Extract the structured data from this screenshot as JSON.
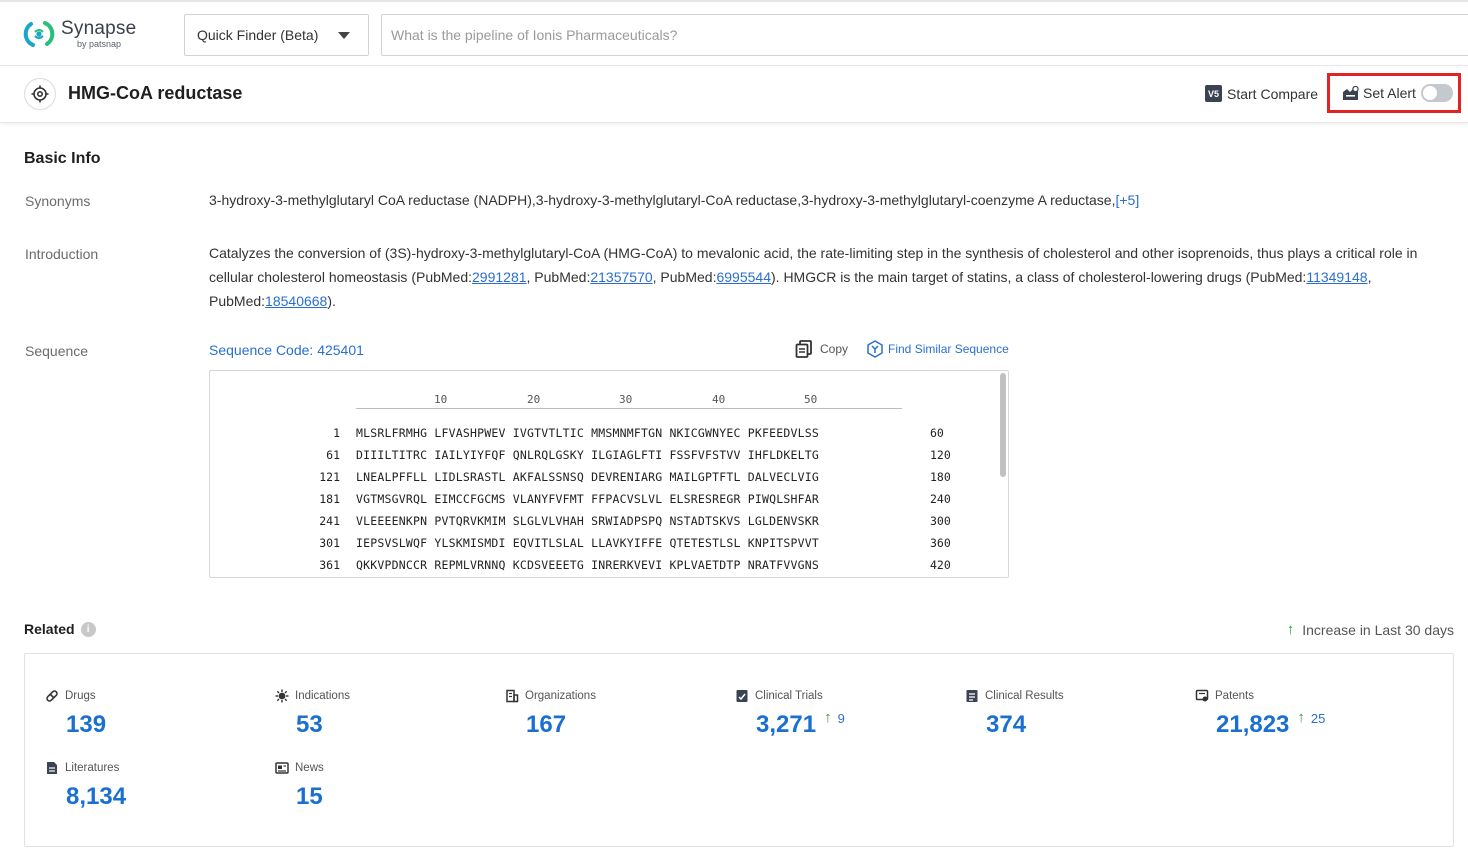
{
  "header": {
    "logo_name": "Synapse",
    "logo_by": "by patsnap",
    "finder_label": "Quick Finder (Beta)",
    "search_placeholder": "What is the pipeline of Ionis Pharmaceuticals?"
  },
  "titlebar": {
    "title": "HMG-CoA reductase",
    "compare_badge": "V5",
    "compare_label": "Start Compare",
    "alert_label": "Set Alert",
    "alert_enabled": false
  },
  "basic_info": {
    "section_title": "Basic Info",
    "synonyms_label": "Synonyms",
    "synonyms_text": "3-hydroxy-3-methylglutaryl CoA reductase (NADPH),3-hydroxy-3-methylglutaryl-CoA reductase,3-hydroxy-3-methylglutaryl-coenzyme A reductase,",
    "synonyms_more": "[+5]",
    "intro_label": "Introduction",
    "intro": {
      "t1": "Catalyzes the conversion of (3S)-hydroxy-3-methylglutaryl-CoA (HMG-CoA) to mevalonic acid, the rate-limiting step in the synthesis of cholesterol and other isoprenoids, thus plays a critical role in cellular cholesterol homeostasis (PubMed:",
      "l1": "2991281",
      "t2": ", PubMed:",
      "l2": "21357570",
      "t3": ", PubMed:",
      "l3": "6995544",
      "t4": "). HMGCR is the main target of statins, a class of cholesterol-lowering drugs (PubMed:",
      "l4": "11349148",
      "t5": ", PubMed:",
      "l5": "18540668",
      "t6": ")."
    },
    "sequence_label": "Sequence",
    "sequence_code": "Sequence Code: 425401",
    "copy_label": "Copy",
    "similar_label": "Find Similar Sequence",
    "ruler": [
      "10",
      "20",
      "30",
      "40",
      "50"
    ],
    "sequence_rows": [
      {
        "start": "1",
        "residues": "MLSRLFRMHG LFVASHPWEV IVGTVTLTIC MMSMNMFTGN NKICGWNYEC PKFEEDVLSS",
        "end": "60"
      },
      {
        "start": "61",
        "residues": "DIIILTITRC IAILYIYFQF QNLRQLGSKY ILGIAGLFTI FSSFVFSTVV IHFLDKELTG",
        "end": "120"
      },
      {
        "start": "121",
        "residues": "LNEALPFFLL LIDLSRASTL AKFALSSNSQ DEVRENIARG MAILGPTFTL DALVECLVIG",
        "end": "180"
      },
      {
        "start": "181",
        "residues": "VGTMSGVRQL EIMCCFGCMS VLANYFVFMT FFPACVSLVL ELSRESREGR PIWQLSHFAR",
        "end": "240"
      },
      {
        "start": "241",
        "residues": "VLEEEENKPN PVTQRVKMIM SLGLVLVHAH SRWIADPSPQ NSTADTSKVS LGLDENVSKR",
        "end": "300"
      },
      {
        "start": "301",
        "residues": "IEPSVSLWQF YLSKMISMDI EQVITLSLAL LLAVKYIFFE QTETESTLSL KNPITSPVVT",
        "end": "360"
      },
      {
        "start": "361",
        "residues": "QKKVPDNCCR REPMLVRNNQ KCDSVEEETG INRERKVEVI KPLVAETDTP NRATFVVGNS",
        "end": "420"
      }
    ]
  },
  "related": {
    "title": "Related",
    "info_icon": "i",
    "increase_note": "Increase in Last 30 days",
    "stats": [
      {
        "key": "drugs",
        "label": "Drugs",
        "value": "139",
        "increase": ""
      },
      {
        "key": "indications",
        "label": "Indications",
        "value": "53",
        "increase": ""
      },
      {
        "key": "organizations",
        "label": "Organizations",
        "value": "167",
        "increase": ""
      },
      {
        "key": "clinical-trials",
        "label": "Clinical Trials",
        "value": "3,271",
        "increase": "9"
      },
      {
        "key": "clinical-results",
        "label": "Clinical Results",
        "value": "374",
        "increase": ""
      },
      {
        "key": "patents",
        "label": "Patents",
        "value": "21,823",
        "increase": "25"
      },
      {
        "key": "literatures",
        "label": "Literatures",
        "value": "8,134",
        "increase": ""
      },
      {
        "key": "news",
        "label": "News",
        "value": "15",
        "increase": ""
      }
    ]
  },
  "colors": {
    "accent": "#1a6fd0",
    "link": "#2a6fcf",
    "increase": "#2e9b3a",
    "alert_highlight": "#e32222"
  }
}
